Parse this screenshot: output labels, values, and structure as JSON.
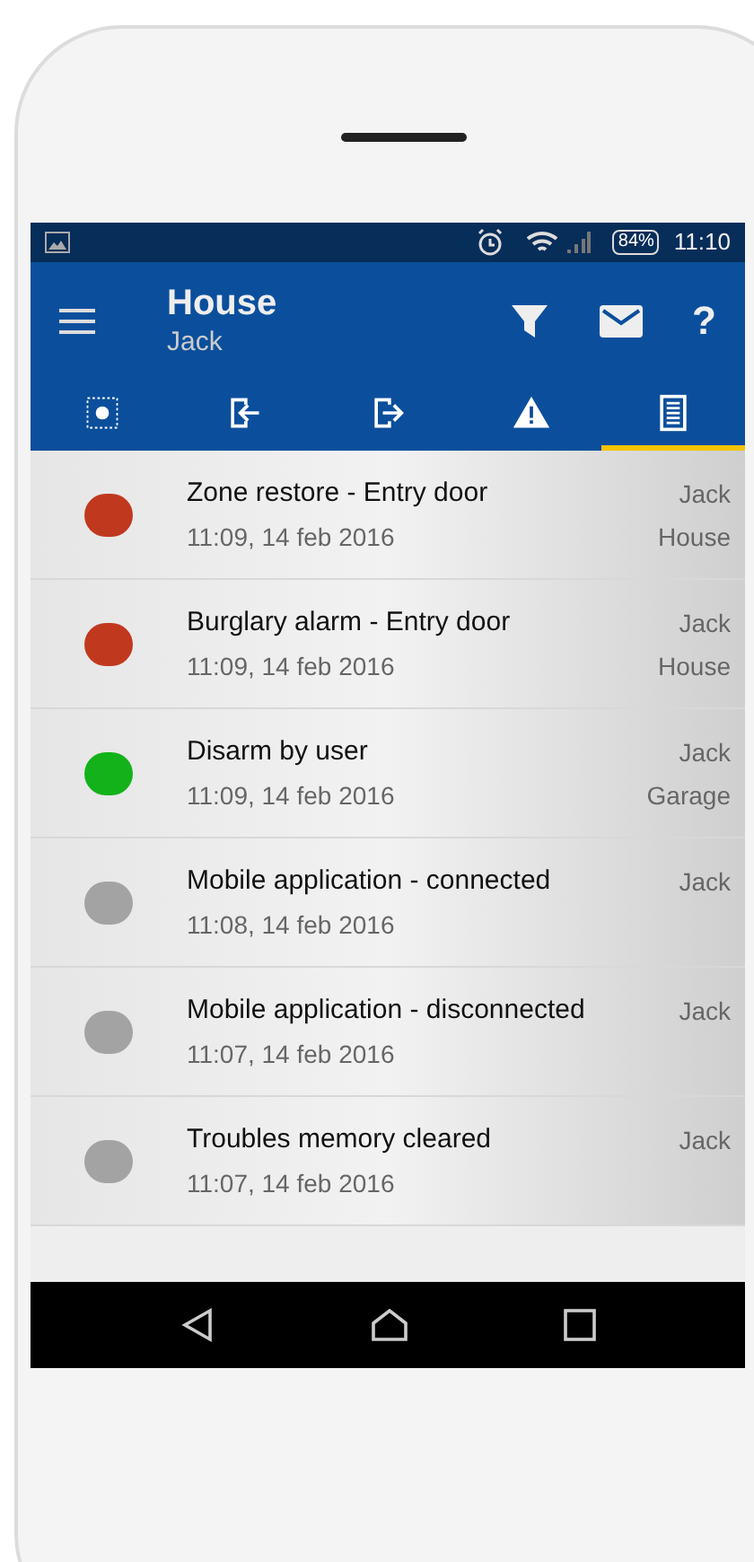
{
  "status_bar": {
    "battery": "84%",
    "time": "11:10"
  },
  "app_bar": {
    "title": "House",
    "subtitle": "Jack",
    "help": "?"
  },
  "tabs": [
    {
      "kind": "panel",
      "selected": false
    },
    {
      "kind": "entry",
      "selected": false
    },
    {
      "kind": "exit",
      "selected": false
    },
    {
      "kind": "alarm",
      "selected": false
    },
    {
      "kind": "log",
      "selected": true
    }
  ],
  "events": [
    {
      "title": "Zone restore - Entry door",
      "time": "11:09, 14 feb 2016",
      "user": "Jack",
      "location": "House",
      "color": "#c0391f"
    },
    {
      "title": "Burglary alarm - Entry door",
      "time": "11:09, 14 feb 2016",
      "user": "Jack",
      "location": "House",
      "color": "#c0391f"
    },
    {
      "title": "Disarm by user",
      "time": "11:09, 14 feb 2016",
      "user": "Jack",
      "location": "Garage",
      "color": "#13b21a"
    },
    {
      "title": "Mobile application - connected",
      "time": "11:08, 14 feb 2016",
      "user": "Jack",
      "color": "#a3a3a3"
    },
    {
      "title": "Mobile application - disconnected",
      "time": "11:07, 14 feb 2016",
      "user": "Jack",
      "color": "#a3a3a3"
    },
    {
      "title": "Troubles memory cleared",
      "time": "11:07, 14 feb 2016",
      "user": "Jack",
      "color": "#a3a3a3"
    }
  ]
}
